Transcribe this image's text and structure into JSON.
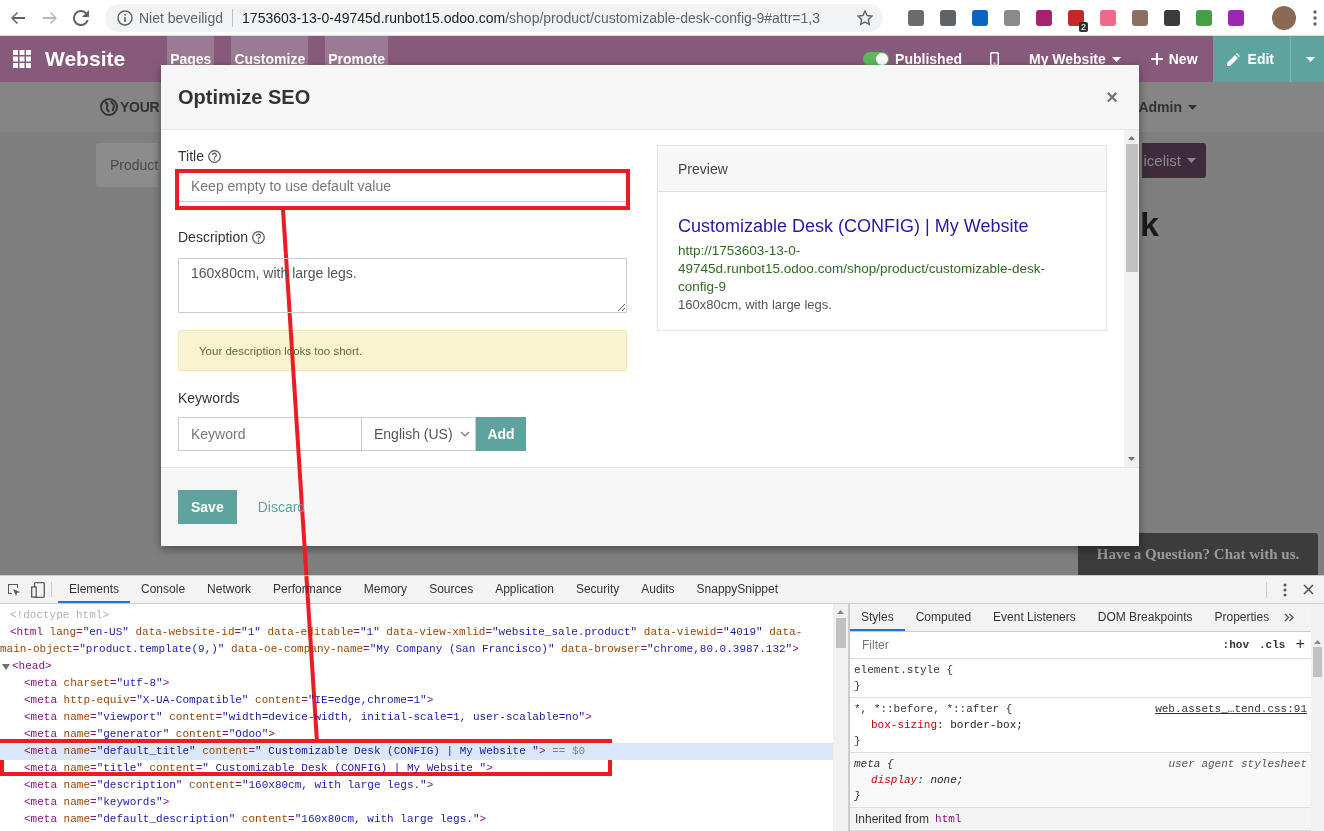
{
  "browser": {
    "security_label": "Niet beveiligd",
    "url_host": "1753603-13-0-49745d.runbot15.odoo.com",
    "url_path": "/shop/product/customizable-desk-config-9#attr=1,3",
    "extensions": [
      {
        "color": "#6b6b6b"
      },
      {
        "color": "#5f6368"
      },
      {
        "color": "#0a66c2"
      },
      {
        "color": "#8a8a8a"
      },
      {
        "color": "#a3236f"
      },
      {
        "color": "#c62828",
        "badge": "2"
      },
      {
        "color": "#ef6a8a"
      },
      {
        "color": "#8d6e63"
      },
      {
        "color": "#3c3c3c"
      },
      {
        "color": "#43a047"
      },
      {
        "color": "#9c27b0"
      }
    ]
  },
  "navbar": {
    "app_title": "Website",
    "menus": [
      {
        "label": "Pages"
      },
      {
        "label": "Customize"
      },
      {
        "label": "Promote"
      }
    ],
    "published": {
      "label": "Published",
      "on": true
    },
    "website_menu": "My Website",
    "new_label": "New",
    "edit_label": "Edit"
  },
  "background_page": {
    "logo_text": "YOUR",
    "user_menu": "Admin",
    "breadcrumb": "Product",
    "pricelist_button": "icelist",
    "heading": "k",
    "chat_button": "Have a Question? Chat with us."
  },
  "dialog": {
    "title": "Optimize SEO",
    "close": "×",
    "title_field": {
      "label": "Title",
      "placeholder": "Keep empty to use default value"
    },
    "description_field": {
      "label": "Description",
      "value": "160x80cm, with large legs."
    },
    "alert": "Your description looks too short.",
    "keywords": {
      "label": "Keywords",
      "placeholder": "Keyword",
      "language": "English (US)",
      "add": "Add"
    },
    "preview": {
      "header": "Preview",
      "title": "Customizable Desk (CONFIG) | My Website",
      "url": "http://1753603-13-0-49745d.runbot15.odoo.com/shop/product/customizable-desk-config-9",
      "description": "160x80cm, with large legs."
    },
    "buttons": [
      {
        "label": "Save",
        "kind": "primary"
      },
      {
        "label": "Discard",
        "kind": "link"
      }
    ]
  },
  "devtools": {
    "tabs": [
      {
        "label": "Elements",
        "selected": true
      },
      {
        "label": "Console",
        "selected": false
      },
      {
        "label": "Network",
        "selected": false
      },
      {
        "label": "Performance",
        "selected": false
      },
      {
        "label": "Memory",
        "selected": false
      },
      {
        "label": "Sources",
        "selected": false
      },
      {
        "label": "Application",
        "selected": false
      },
      {
        "label": "Security",
        "selected": false
      },
      {
        "label": "Audits",
        "selected": false
      },
      {
        "label": "SnappySnippet",
        "selected": false
      }
    ],
    "tree": [
      {
        "selected": false,
        "lines": [
          [
            {
              "kind": "doctype",
              "text": "<!doctype html>"
            }
          ]
        ]
      },
      {
        "selected": false,
        "lines": [
          [
            {
              "kind": "tag",
              "text": "<html"
            },
            {
              "kind": "attr",
              "text": " lang"
            },
            {
              "kind": "tag",
              "text": "="
            },
            {
              "kind": "val",
              "text": "\"en-US\""
            },
            {
              "kind": "attr",
              "text": " data-website-id"
            },
            {
              "kind": "tag",
              "text": "="
            },
            {
              "kind": "val",
              "text": "\"1\""
            },
            {
              "kind": "attr",
              "text": " data-editable"
            },
            {
              "kind": "tag",
              "text": "="
            },
            {
              "kind": "val",
              "text": "\"1\""
            },
            {
              "kind": "attr",
              "text": " data-view-xmlid"
            },
            {
              "kind": "tag",
              "text": "="
            },
            {
              "kind": "val",
              "text": "\"website_sale.product\""
            },
            {
              "kind": "attr",
              "text": " data-viewid"
            },
            {
              "kind": "tag",
              "text": "="
            },
            {
              "kind": "val",
              "text": "\"4019\""
            },
            {
              "kind": "attr",
              "text": " data-"
            }
          ],
          [
            {
              "kind": "attr",
              "text": "main-object"
            },
            {
              "kind": "tag",
              "text": "="
            },
            {
              "kind": "val",
              "text": "\"product.template(9,)\""
            },
            {
              "kind": "attr",
              "text": " data-oe-company-name"
            },
            {
              "kind": "tag",
              "text": "="
            },
            {
              "kind": "val",
              "text": "\"My Company (San Francisco)\""
            },
            {
              "kind": "attr",
              "text": " data-browser"
            },
            {
              "kind": "tag",
              "text": "="
            },
            {
              "kind": "val",
              "text": "\"chrome,80.0.3987.132\""
            },
            {
              "kind": "tag",
              "text": ">"
            }
          ]
        ],
        "children": [
          {
            "selected": false,
            "expanded": true,
            "lines": [
              [
                {
                  "kind": "tag",
                  "text": "<head>"
                }
              ]
            ],
            "children": [
              {
                "selected": false,
                "lines": [
                  [
                    {
                      "kind": "tag",
                      "text": "<meta"
                    },
                    {
                      "kind": "attr",
                      "text": " charset"
                    },
                    {
                      "kind": "tag",
                      "text": "="
                    },
                    {
                      "kind": "val",
                      "text": "\"utf-8\""
                    },
                    {
                      "kind": "tag",
                      "text": ">"
                    }
                  ]
                ]
              },
              {
                "selected": false,
                "lines": [
                  [
                    {
                      "kind": "tag",
                      "text": "<meta"
                    },
                    {
                      "kind": "attr",
                      "text": " http-equiv"
                    },
                    {
                      "kind": "tag",
                      "text": "="
                    },
                    {
                      "kind": "val",
                      "text": "\"X-UA-Compatible\""
                    },
                    {
                      "kind": "attr",
                      "text": " content"
                    },
                    {
                      "kind": "tag",
                      "text": "="
                    },
                    {
                      "kind": "val",
                      "text": "\"IE=edge,chrome=1\""
                    },
                    {
                      "kind": "tag",
                      "text": ">"
                    }
                  ]
                ]
              },
              {
                "selected": false,
                "lines": [
                  [
                    {
                      "kind": "tag",
                      "text": "<meta"
                    },
                    {
                      "kind": "attr",
                      "text": " name"
                    },
                    {
                      "kind": "tag",
                      "text": "="
                    },
                    {
                      "kind": "val",
                      "text": "\"viewport\""
                    },
                    {
                      "kind": "attr",
                      "text": " content"
                    },
                    {
                      "kind": "tag",
                      "text": "="
                    },
                    {
                      "kind": "val",
                      "text": "\"width=device-width, initial-scale=1, user-scalable=no\""
                    },
                    {
                      "kind": "tag",
                      "text": ">"
                    }
                  ]
                ]
              },
              {
                "selected": false,
                "lines": [
                  [
                    {
                      "kind": "tag",
                      "text": "<meta"
                    },
                    {
                      "kind": "attr",
                      "text": " name"
                    },
                    {
                      "kind": "tag",
                      "text": "="
                    },
                    {
                      "kind": "val",
                      "text": "\"generator\""
                    },
                    {
                      "kind": "attr",
                      "text": " content"
                    },
                    {
                      "kind": "tag",
                      "text": "="
                    },
                    {
                      "kind": "val",
                      "text": "\"Odoo\""
                    },
                    {
                      "kind": "tag",
                      "text": ">"
                    }
                  ]
                ]
              },
              {
                "selected": true,
                "lines": [
                  [
                    {
                      "kind": "tag",
                      "text": "<meta"
                    },
                    {
                      "kind": "attr",
                      "text": " name"
                    },
                    {
                      "kind": "tag",
                      "text": "="
                    },
                    {
                      "kind": "val",
                      "text": "\"default_title\""
                    },
                    {
                      "kind": "attr",
                      "text": " content"
                    },
                    {
                      "kind": "tag",
                      "text": "="
                    },
                    {
                      "kind": "val",
                      "text": "\" Customizable Desk (CONFIG) | My Website \""
                    },
                    {
                      "kind": "tag",
                      "text": ">"
                    },
                    {
                      "kind": "ref",
                      "text": " == $0"
                    }
                  ]
                ]
              },
              {
                "selected": false,
                "lines": [
                  [
                    {
                      "kind": "tag",
                      "text": "<meta"
                    },
                    {
                      "kind": "attr",
                      "text": " name"
                    },
                    {
                      "kind": "tag",
                      "text": "="
                    },
                    {
                      "kind": "val",
                      "text": "\"title\""
                    },
                    {
                      "kind": "attr",
                      "text": " content"
                    },
                    {
                      "kind": "tag",
                      "text": "="
                    },
                    {
                      "kind": "val",
                      "text": "\" Customizable Desk (CONFIG) | My Website \""
                    },
                    {
                      "kind": "tag",
                      "text": ">"
                    }
                  ]
                ]
              },
              {
                "selected": false,
                "lines": [
                  [
                    {
                      "kind": "tag",
                      "text": "<meta"
                    },
                    {
                      "kind": "attr",
                      "text": " name"
                    },
                    {
                      "kind": "tag",
                      "text": "="
                    },
                    {
                      "kind": "val",
                      "text": "\"description\""
                    },
                    {
                      "kind": "attr",
                      "text": " content"
                    },
                    {
                      "kind": "tag",
                      "text": "="
                    },
                    {
                      "kind": "val",
                      "text": "\"160x80cm, with large legs.\""
                    },
                    {
                      "kind": "tag",
                      "text": ">"
                    }
                  ]
                ]
              },
              {
                "selected": false,
                "lines": [
                  [
                    {
                      "kind": "tag",
                      "text": "<meta"
                    },
                    {
                      "kind": "attr",
                      "text": " name"
                    },
                    {
                      "kind": "tag",
                      "text": "="
                    },
                    {
                      "kind": "val",
                      "text": "\"keywords\""
                    },
                    {
                      "kind": "tag",
                      "text": ">"
                    }
                  ]
                ]
              },
              {
                "selected": false,
                "lines": [
                  [
                    {
                      "kind": "tag",
                      "text": "<meta"
                    },
                    {
                      "kind": "attr",
                      "text": " name"
                    },
                    {
                      "kind": "tag",
                      "text": "="
                    },
                    {
                      "kind": "val",
                      "text": "\"default_description\""
                    },
                    {
                      "kind": "attr",
                      "text": " content"
                    },
                    {
                      "kind": "tag",
                      "text": "="
                    },
                    {
                      "kind": "val",
                      "text": "\"160x80cm, with large legs.\""
                    },
                    {
                      "kind": "tag",
                      "text": ">"
                    }
                  ]
                ]
              }
            ]
          }
        ]
      }
    ],
    "style_tabs": [
      {
        "label": "Styles",
        "selected": true
      },
      {
        "label": "Computed",
        "selected": false
      },
      {
        "label": "Event Listeners",
        "selected": false
      },
      {
        "label": "DOM Breakpoints",
        "selected": false
      },
      {
        "label": "Properties",
        "selected": false
      }
    ],
    "filter_placeholder": "Filter",
    "hov": ":hov",
    "cls": ".cls",
    "add": "+",
    "rules": [
      {
        "kind": "author",
        "selector": "element.style {",
        "close": "}"
      },
      {
        "kind": "author",
        "selector": "*, *::before, *::after {",
        "source": "web.assets_…tend.css:91",
        "close": "}",
        "declarations": [
          [
            {
              "kind": "prop",
              "text": "box-sizing"
            },
            {
              "kind": "plain",
              "text": ": border-box;"
            }
          ]
        ]
      },
      {
        "kind": "user_agent",
        "selector": "meta {",
        "source": "user agent stylesheet",
        "close": "}",
        "declarations": [
          [
            {
              "kind": "prop",
              "text": "display"
            },
            {
              "kind": "plain",
              "text": ": none;"
            }
          ]
        ]
      }
    ],
    "inherited": {
      "label": "Inherited from",
      "element": "html"
    }
  }
}
